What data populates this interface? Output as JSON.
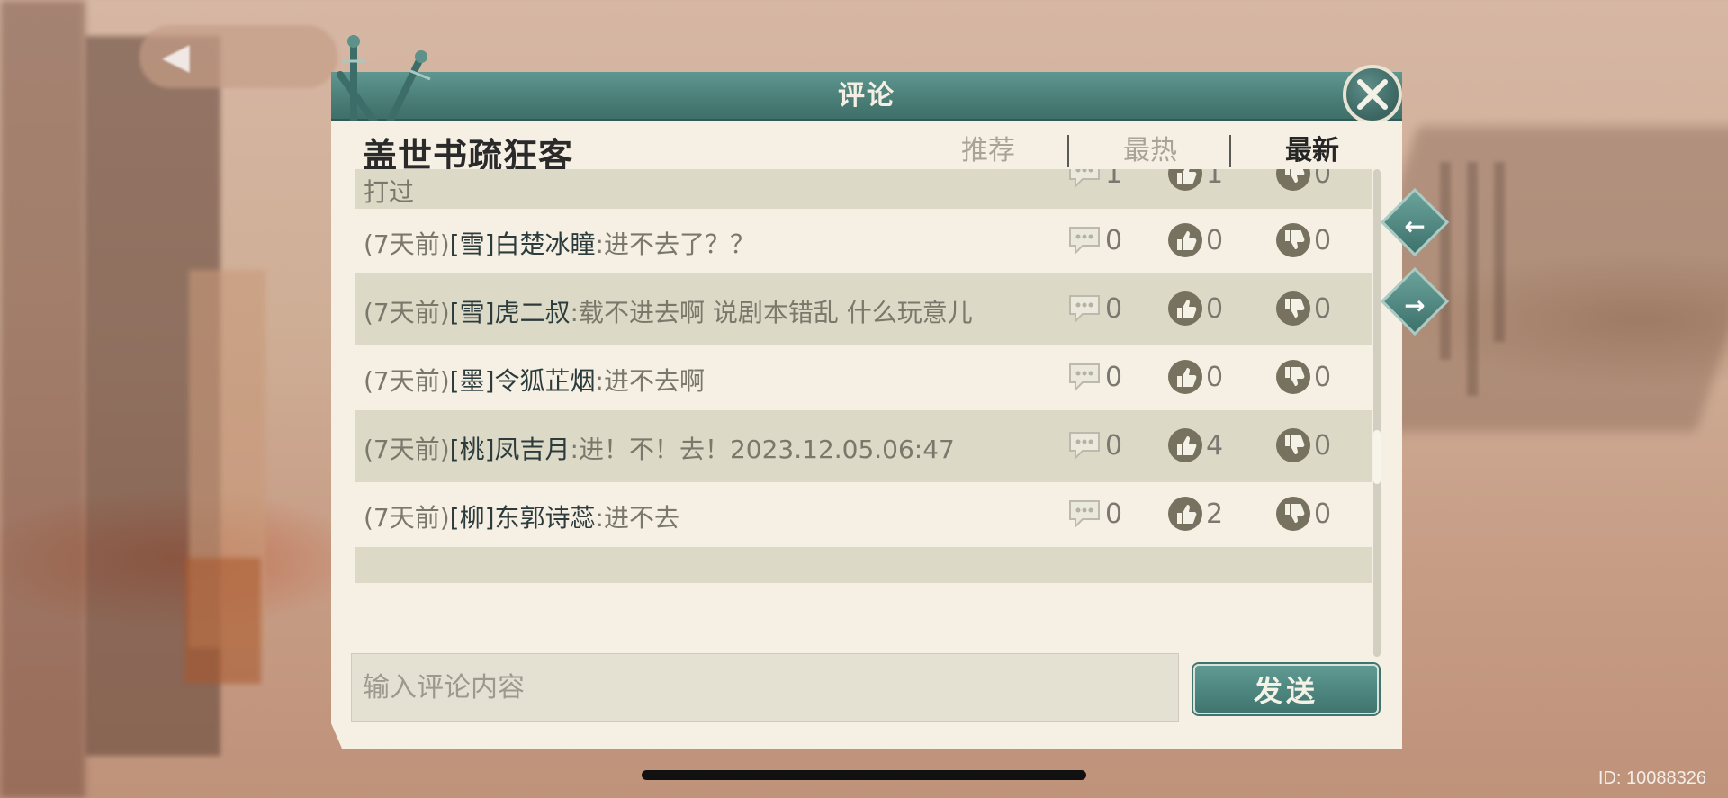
{
  "dialog": {
    "title": "评论",
    "page_header": "盖世书疏狂客"
  },
  "tabs": [
    {
      "label": "推荐",
      "active": false
    },
    {
      "label": "最热",
      "active": false
    },
    {
      "label": "最新",
      "active": true
    }
  ],
  "comments": [
    {
      "prefix": "",
      "user": "",
      "text": "打过",
      "replies": "1",
      "likes": "1",
      "dislikes": "0",
      "partial": true
    },
    {
      "prefix": "(7天前)",
      "user": "[雪]白楚冰瞳",
      "text": ":进不去了？？",
      "replies": "0",
      "likes": "0",
      "dislikes": "0"
    },
    {
      "prefix": "(7天前)",
      "user": "[雪]虎二叔",
      "text": ":载不进去啊 说剧本错乱 什么玩意儿",
      "replies": "0",
      "likes": "0",
      "dislikes": "0"
    },
    {
      "prefix": "(7天前)",
      "user": "[墨]令狐芷烟",
      "text": ":进不去啊",
      "replies": "0",
      "likes": "0",
      "dislikes": "0"
    },
    {
      "prefix": "(7天前)",
      "user": "[桃]凤吉月",
      "text": ":进！不！去！2023.12.05.06:47",
      "replies": "0",
      "likes": "4",
      "dislikes": "0"
    },
    {
      "prefix": "(7天前)",
      "user": "[柳]东郭诗蕊",
      "text": ":进不去",
      "replies": "0",
      "likes": "2",
      "dislikes": "0"
    }
  ],
  "input": {
    "placeholder": "输入评论内容",
    "value": ""
  },
  "send_label": "发送",
  "nav": {
    "prev": "←",
    "next": "→"
  },
  "footer": {
    "id_text": "ID: 10088326"
  },
  "colors": {
    "header_teal": "#4b7f78",
    "panel_bg": "#f6efe3",
    "alt_row": "#dcd9c6"
  }
}
